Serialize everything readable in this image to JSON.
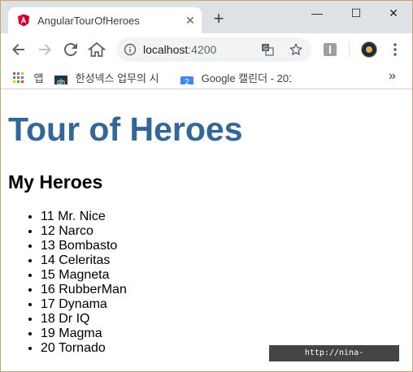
{
  "browser": {
    "tab": {
      "title": "AngularTourOfHeroes",
      "favicon": "angular-icon",
      "close": "✕"
    },
    "new_tab": "+",
    "window_controls": {
      "minimize": "—",
      "maximize": "☐",
      "close": "✕"
    },
    "address": {
      "host": "localhost",
      "port": ":4200"
    },
    "bookmarks": [
      {
        "label": "앱",
        "icon": "apps-grid-icon"
      },
      {
        "label": "한성넥스 업무의 시",
        "icon": "dh-icon"
      },
      {
        "label": "Google 캘린더 - 201",
        "icon": "calendar-icon",
        "badge": "2"
      }
    ],
    "bookmarks_more": "»"
  },
  "page": {
    "title": "Tour of Heroes",
    "title_color": "#336699",
    "subtitle": "My Heroes",
    "heroes": [
      {
        "id": "11",
        "name": "Mr. Nice"
      },
      {
        "id": "12",
        "name": "Narco"
      },
      {
        "id": "13",
        "name": "Bombasto"
      },
      {
        "id": "14",
        "name": "Celeritas"
      },
      {
        "id": "15",
        "name": "Magneta"
      },
      {
        "id": "16",
        "name": "RubberMan"
      },
      {
        "id": "17",
        "name": "Dynama"
      },
      {
        "id": "18",
        "name": "Dr IQ"
      },
      {
        "id": "19",
        "name": "Magma"
      },
      {
        "id": "20",
        "name": "Tornado"
      }
    ]
  },
  "watermark": "http://nina-life.tistory.com"
}
